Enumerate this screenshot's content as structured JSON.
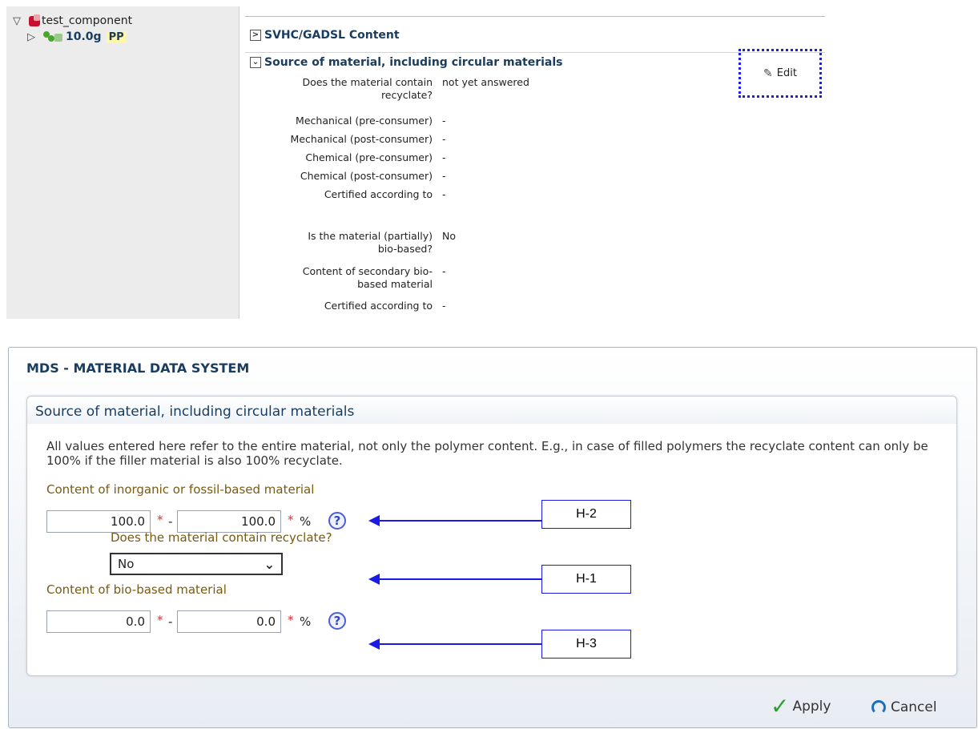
{
  "tree": {
    "root": {
      "toggle": "▽",
      "label": "test_component"
    },
    "child": {
      "toggle": "▷",
      "weight": "10.0g",
      "badge": "PP"
    }
  },
  "detail": {
    "svhc_section": {
      "toggle": ">",
      "title": "SVHC/GADSL Content"
    },
    "source_section": {
      "toggle": "⌄",
      "title": "Source of material, including circular materials"
    },
    "edit_label": "Edit",
    "rows": [
      {
        "label": "Does the material contain\nrecyclate?",
        "value": "not yet answered"
      },
      {
        "label": "Mechanical (pre-consumer)",
        "value": "-"
      },
      {
        "label": "Mechanical (post-consumer)",
        "value": "-"
      },
      {
        "label": "Chemical (pre-consumer)",
        "value": "-"
      },
      {
        "label": "Chemical (post-consumer)",
        "value": "-"
      },
      {
        "label": "Certified according to",
        "value": "-"
      },
      {
        "label": "Is the material (partially)\nbio-based?",
        "value": "No"
      },
      {
        "label": "Content of secondary bio-\nbased material",
        "value": "-"
      },
      {
        "label": "Certified according to",
        "value": "-"
      }
    ]
  },
  "dialog": {
    "title": "MDS - MATERIAL DATA SYSTEM",
    "section_title": "Source of material, including circular materials",
    "intro": "All values entered here refer to the entire material, not only the polymer content. E.g., in case of filled polymers the recyclate content can only be 100% if the filler material is also 100% recyclate.",
    "inorganic": {
      "label": "Content of inorganic or fossil-based material",
      "min": "100.0",
      "max": "100.0",
      "required_mark": "*",
      "dash": "-",
      "unit": "%",
      "help": "?"
    },
    "recyclate": {
      "label": "Does the material contain recyclate?",
      "selected": "No",
      "chevron": "⌄"
    },
    "biobased": {
      "label": "Content of bio-based material",
      "min": "0.0",
      "max": "0.0",
      "required_mark": "*",
      "dash": "-",
      "unit": "%",
      "help": "?"
    },
    "apply_label": "Apply",
    "cancel_label": "Cancel"
  },
  "callouts": {
    "h2": "H-2",
    "h1": "H-1",
    "h3": "H-3"
  },
  "colors": {
    "arrow": "#1a1ae6",
    "edit_highlight": "#1d1df0",
    "required": "#e0302f",
    "label_gold": "#7a5a10"
  }
}
